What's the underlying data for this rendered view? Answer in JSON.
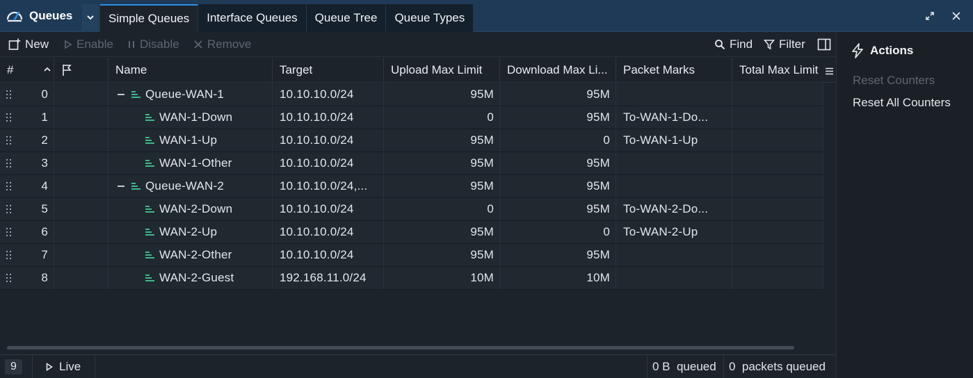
{
  "app": {
    "title": "Queues"
  },
  "tabs": [
    "Simple Queues",
    "Interface Queues",
    "Queue Tree",
    "Queue Types"
  ],
  "toolbar": {
    "new": "New",
    "enable": "Enable",
    "disable": "Disable",
    "remove": "Remove",
    "find": "Find",
    "filter": "Filter"
  },
  "columns": [
    "#",
    "Name",
    "Target",
    "Upload Max Limit",
    "Download Max Li...",
    "Packet Marks",
    "Total Max Limit"
  ],
  "rows": [
    {
      "num": "0",
      "name": "Queue-WAN-1",
      "target": "10.10.10.0/24",
      "upload": "95M",
      "download": "95M",
      "marks": "",
      "parent": true
    },
    {
      "num": "1",
      "name": "WAN-1-Down",
      "target": "10.10.10.0/24",
      "upload": "0",
      "download": "95M",
      "marks": "To-WAN-1-Do...",
      "parent": false
    },
    {
      "num": "2",
      "name": "WAN-1-Up",
      "target": "10.10.10.0/24",
      "upload": "95M",
      "download": "0",
      "marks": "To-WAN-1-Up",
      "parent": false
    },
    {
      "num": "3",
      "name": "WAN-1-Other",
      "target": "10.10.10.0/24",
      "upload": "95M",
      "download": "95M",
      "marks": "",
      "parent": false
    },
    {
      "num": "4",
      "name": "Queue-WAN-2",
      "target": "10.10.10.0/24,...",
      "upload": "95M",
      "download": "95M",
      "marks": "",
      "parent": true
    },
    {
      "num": "5",
      "name": "WAN-2-Down",
      "target": "10.10.10.0/24",
      "upload": "0",
      "download": "95M",
      "marks": "To-WAN-2-Do...",
      "parent": false
    },
    {
      "num": "6",
      "name": "WAN-2-Up",
      "target": "10.10.10.0/24",
      "upload": "95M",
      "download": "0",
      "marks": "To-WAN-2-Up",
      "parent": false
    },
    {
      "num": "7",
      "name": "WAN-2-Other",
      "target": "10.10.10.0/24",
      "upload": "95M",
      "download": "95M",
      "marks": "",
      "parent": false
    },
    {
      "num": "8",
      "name": "WAN-2-Guest",
      "target": "192.168.11.0/24",
      "upload": "10M",
      "download": "10M",
      "marks": "",
      "parent": false
    }
  ],
  "status": {
    "count": "9",
    "live": "Live",
    "bytes_queued": "0 B  queued",
    "packets_queued": "0  packets queued"
  },
  "actions": {
    "title": "Actions",
    "reset_counters": "Reset Counters",
    "reset_all_counters": "Reset All Counters"
  },
  "colors": {
    "accent": "#2f8fe0",
    "titlebar": "#1f3a56",
    "queue_icon": "#3fb88a"
  }
}
